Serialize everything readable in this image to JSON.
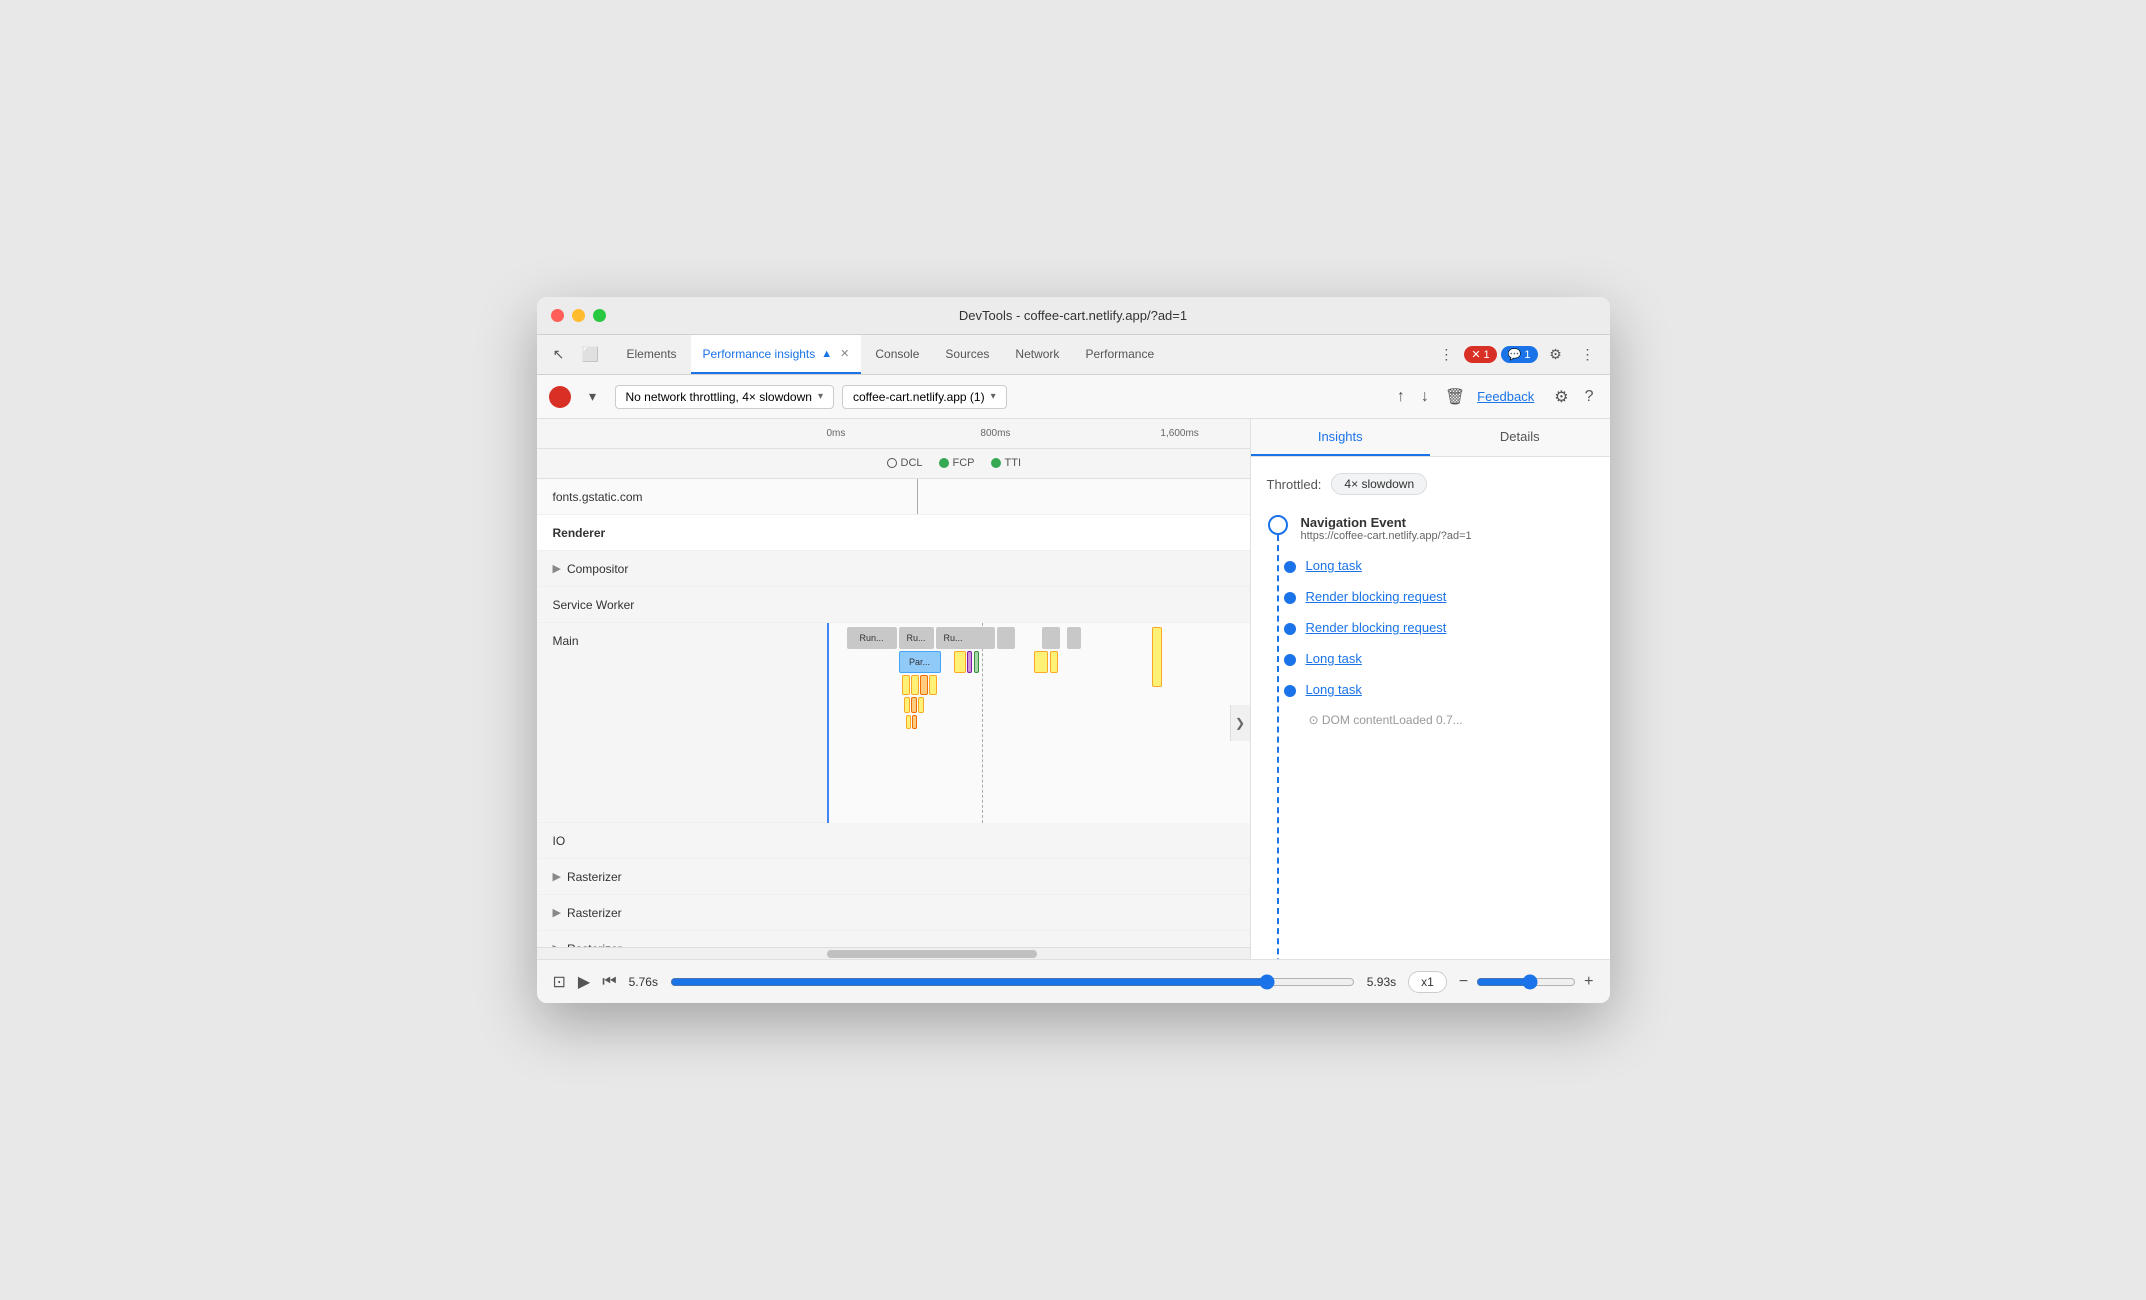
{
  "window": {
    "title": "DevTools - coffee-cart.netlify.app/?ad=1"
  },
  "tabs": {
    "items": [
      {
        "label": "Elements",
        "active": false
      },
      {
        "label": "Performance insights",
        "active": true
      },
      {
        "label": "Console",
        "active": false
      },
      {
        "label": "Sources",
        "active": false
      },
      {
        "label": "Network",
        "active": false
      },
      {
        "label": "Performance",
        "active": false
      }
    ],
    "more_label": "»",
    "error_count": "1",
    "info_count": "1"
  },
  "toolbar": {
    "network_throttle": "No network throttling, 4× slowdown",
    "page_select": "coffee-cart.netlify.app (1)",
    "feedback_label": "Feedback"
  },
  "timeline": {
    "ruler_marks": [
      "0ms",
      "800ms",
      "1,600ms"
    ],
    "markers": [
      {
        "label": "DCL",
        "color": "empty"
      },
      {
        "label": "FCP",
        "color": "#34a853"
      },
      {
        "label": "TTI",
        "color": "#34a853"
      }
    ],
    "rows": [
      {
        "label": "fonts.gstatic.com",
        "bold": false
      },
      {
        "label": "Renderer",
        "bold": true
      },
      {
        "label": "Compositor",
        "bold": false,
        "expand": true
      },
      {
        "label": "Service Worker",
        "bold": false
      },
      {
        "label": "Main",
        "bold": false
      },
      {
        "label": "IO",
        "bold": false
      },
      {
        "label": "Rasterizer",
        "bold": false,
        "expand": true
      },
      {
        "label": "Rasterizer",
        "bold": false,
        "expand": true
      },
      {
        "label": "Rasterizer",
        "bold": false,
        "expand": true
      }
    ]
  },
  "insights_panel": {
    "tabs": [
      "Insights",
      "Details"
    ],
    "active_tab": "Insights",
    "throttle_label": "Throttled:",
    "throttle_value": "4× slowdown",
    "nav_event_title": "Navigation Event",
    "nav_event_url": "https://coffee-cart.netlify.app/?ad=1",
    "items": [
      {
        "label": "Long task",
        "type": "link"
      },
      {
        "label": "Render blocking request",
        "type": "link"
      },
      {
        "label": "Render blocking request",
        "type": "link"
      },
      {
        "label": "Long task",
        "type": "link"
      },
      {
        "label": "Long task",
        "type": "link"
      },
      {
        "label": "DOM contentLoaded 0.7...",
        "type": "link",
        "partial": true
      }
    ]
  },
  "bottom_controls": {
    "time_start": "5.76s",
    "time_end": "5.93s",
    "speed": "x1",
    "zoom_min_icon": "zoom-out",
    "zoom_max_icon": "zoom-in"
  },
  "icons": {
    "record": "●",
    "play": "▶",
    "skip-back": "⏮",
    "chevron-down": "▾",
    "chevron-right": "❯",
    "expand": "❯",
    "upload": "↑",
    "download": "↓",
    "trash": "🗑",
    "settings": "⚙",
    "close": "✕",
    "cursor": "↖",
    "inspect": "⬜",
    "more": "⋮",
    "screenshot": "⊡",
    "zoom-out": "−",
    "zoom-in": "+"
  }
}
